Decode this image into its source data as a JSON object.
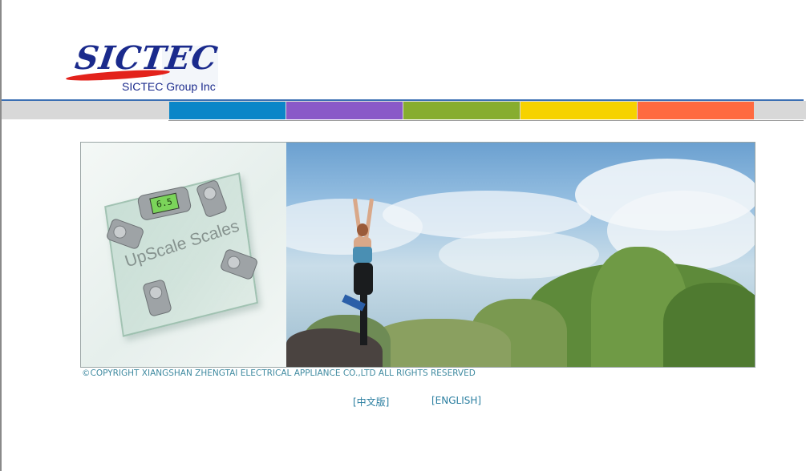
{
  "header": {
    "logo_wordmark": "SICTEC",
    "company_name": "SICTEC Group Inc",
    "brand_color": "#1a2a8c",
    "swoosh_color": "#e3221b"
  },
  "nav": {
    "bar_color": "#d8d8d8",
    "segments": [
      {
        "name": "nav-segment-blue",
        "color": "#0a86c8"
      },
      {
        "name": "nav-segment-purple",
        "color": "#8a59c8"
      },
      {
        "name": "nav-segment-green",
        "color": "#87ad2f"
      },
      {
        "name": "nav-segment-yellow",
        "color": "#f6d200"
      },
      {
        "name": "nav-segment-orange",
        "color": "#ff6a40"
      }
    ]
  },
  "banner": {
    "product_text": "UpScale Scales",
    "scale_readout": "6.5"
  },
  "footer": {
    "copyright": "©COPYRIGHT XIANGSHAN ZHENGTAI ELECTRICAL APPLIANCE CO.,LTD ALL RIGHTS RESERVED",
    "lang_chinese": "[中文版]",
    "lang_english": "[ENGLISH]",
    "link_color": "#2a7ea0"
  }
}
